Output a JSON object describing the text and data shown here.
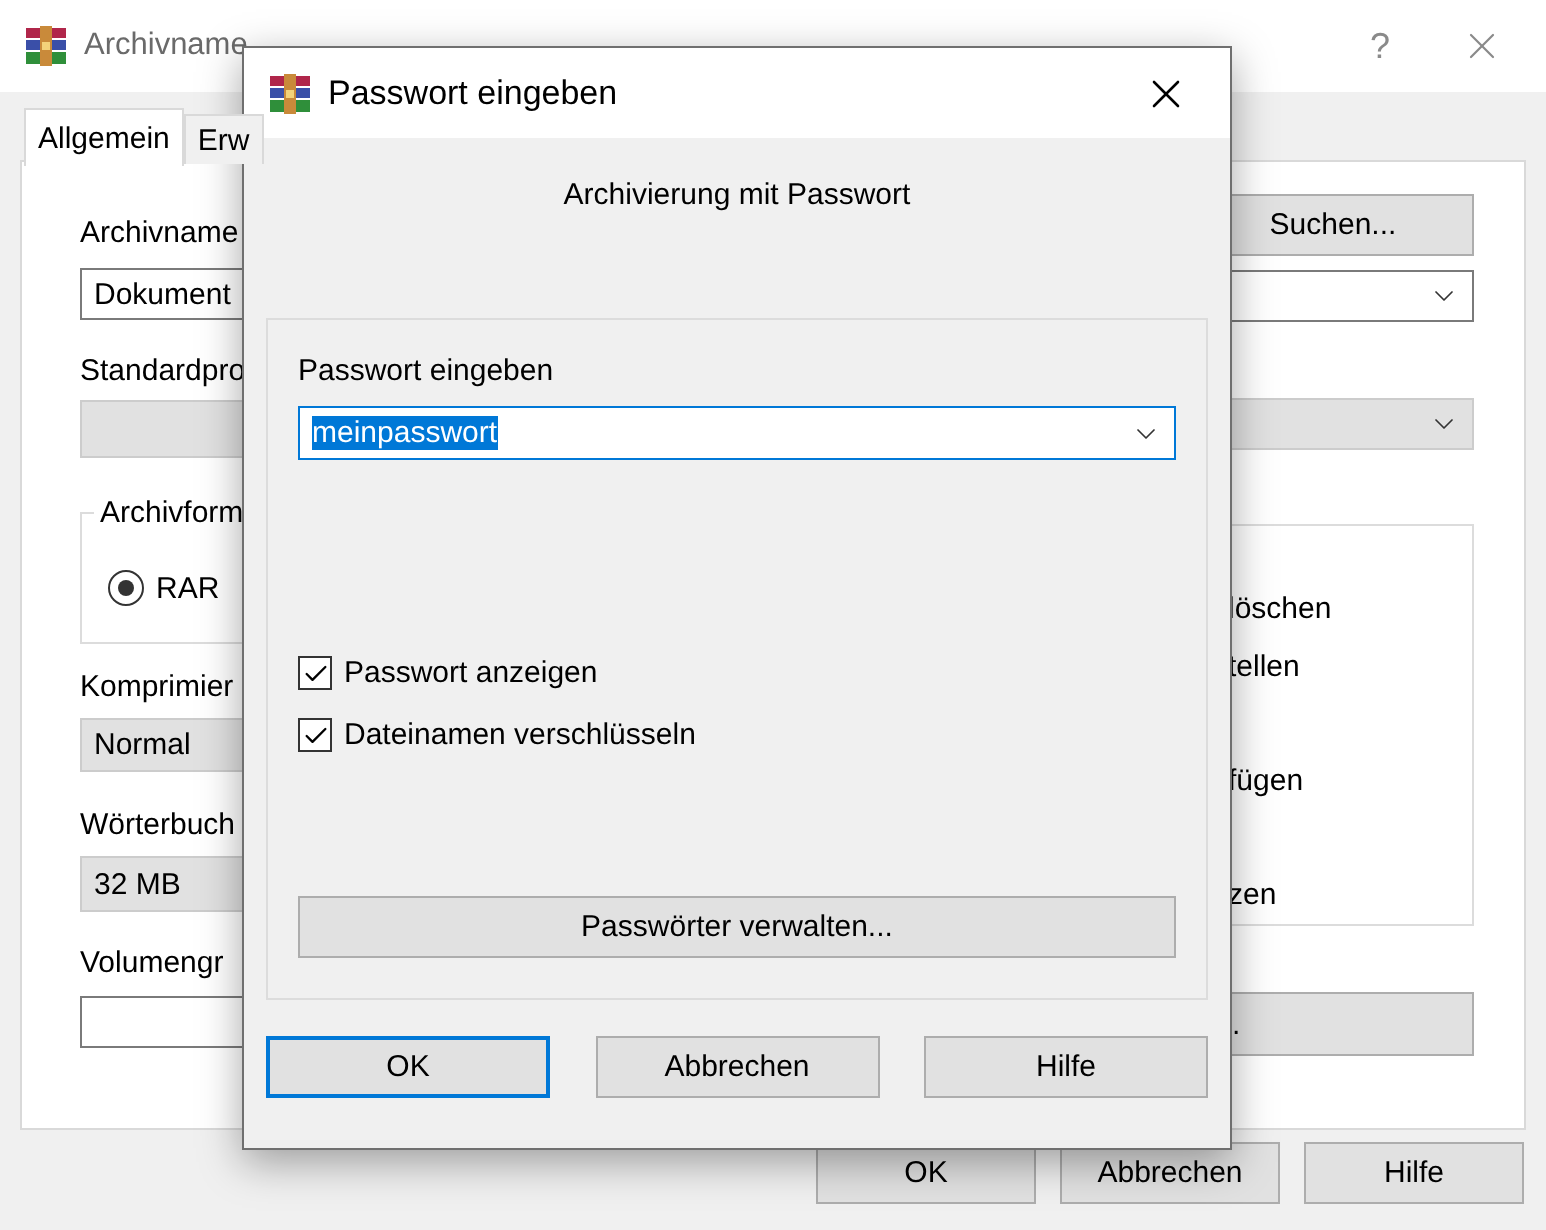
{
  "main_window": {
    "title": "Archivname",
    "help": "?",
    "tabs": [
      {
        "label": "Allgemein",
        "selected": true
      },
      {
        "label": "Erw",
        "selected": false
      }
    ],
    "archive_name": {
      "label": "Archivname",
      "value": "Dokument"
    },
    "profile": {
      "label": "Standardpro"
    },
    "format": {
      "label": "Archivform",
      "options": [
        {
          "label": "RAR",
          "selected": true
        }
      ]
    },
    "compression": {
      "label": "Komprimier",
      "value": "Normal"
    },
    "dictionary": {
      "label": "Wörterbuch",
      "value": "32 MB"
    },
    "volume": {
      "label": "Volumengr"
    },
    "browse_button": "Suchen...",
    "options": [
      "löschen",
      "tellen",
      "fügen",
      "zen"
    ],
    "partial_button": ".",
    "buttons": [
      "OK",
      "Abbrechen",
      "Hilfe"
    ]
  },
  "dialog": {
    "title": "Passwort eingeben",
    "heading": "Archivierung mit Passwort",
    "password": {
      "label": "Passwort eingeben",
      "value": "meinpasswort"
    },
    "checkboxes": [
      {
        "label": "Passwort anzeigen",
        "checked": true
      },
      {
        "label": "Dateinamen verschlüsseln",
        "checked": true
      }
    ],
    "manage_button": "Passwörter verwalten...",
    "buttons": [
      {
        "label": "OK",
        "default": true
      },
      {
        "label": "Abbrechen",
        "default": false
      },
      {
        "label": "Hilfe",
        "default": false
      }
    ]
  }
}
